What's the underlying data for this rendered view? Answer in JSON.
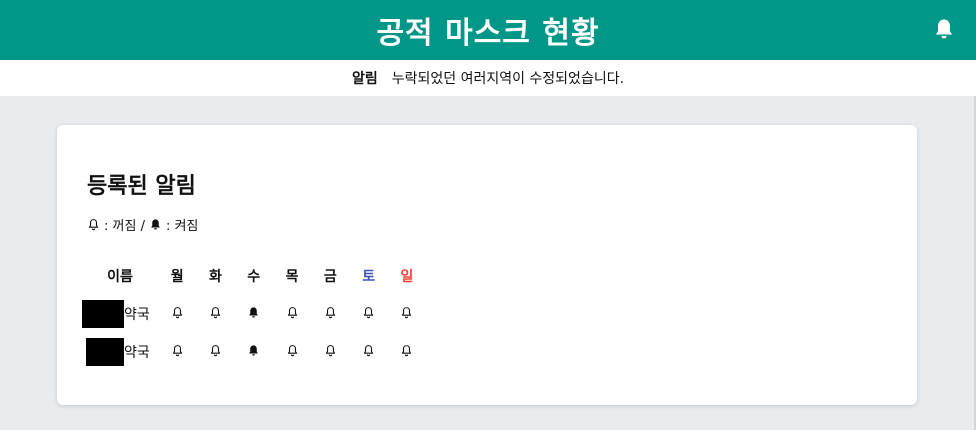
{
  "header": {
    "title": "공적 마스크 현황",
    "bell_icon": "bell-icon"
  },
  "notice": {
    "label": "알림",
    "message": "누락되었던 여러지역이 수정되었습니다."
  },
  "card": {
    "title": "등록된 알림",
    "legend": {
      "off_text": ": 꺼짐 /",
      "on_text": ": 켜짐"
    }
  },
  "table": {
    "headers": {
      "name": "이름",
      "days": [
        "월",
        "화",
        "수",
        "목",
        "금",
        "토",
        "일"
      ]
    },
    "rows": [
      {
        "name_suffix": "약국",
        "states": [
          false,
          false,
          true,
          false,
          false,
          false,
          false
        ]
      },
      {
        "name_suffix": "약국",
        "states": [
          false,
          false,
          true,
          false,
          false,
          false,
          false
        ]
      }
    ]
  },
  "colors": {
    "header": "#009688",
    "saturday": "#3f51b5",
    "sunday": "#f44336"
  }
}
